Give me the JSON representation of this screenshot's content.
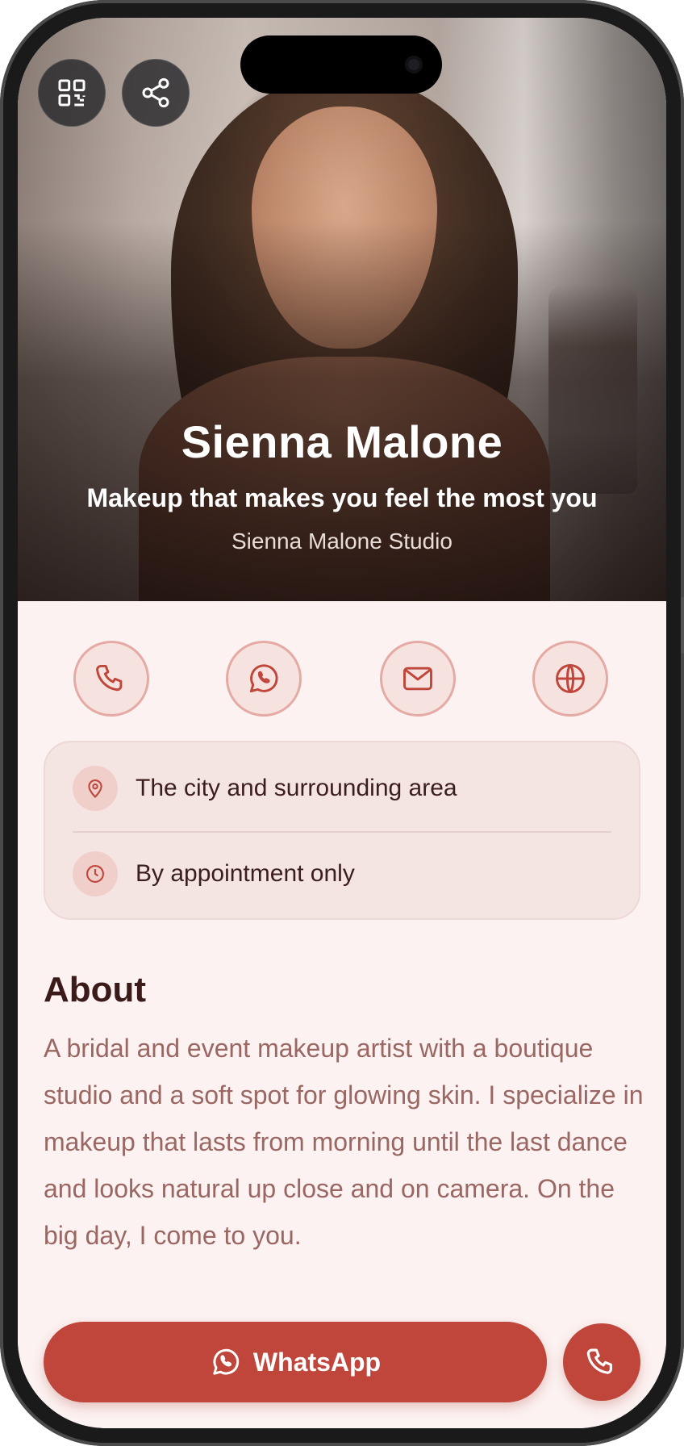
{
  "hero": {
    "name": "Sienna Malone",
    "tagline": "Makeup that makes you feel the most you",
    "studio": "Sienna Malone Studio",
    "buttons": {
      "qr_icon": "qr-code-icon",
      "share_icon": "share-icon"
    }
  },
  "actions": [
    {
      "id": "phone",
      "icon": "phone-icon"
    },
    {
      "id": "whatsapp",
      "icon": "whatsapp-icon"
    },
    {
      "id": "email",
      "icon": "mail-icon"
    },
    {
      "id": "website",
      "icon": "globe-icon"
    }
  ],
  "info": {
    "location": "The city and surrounding area",
    "hours": "By appointment only"
  },
  "about": {
    "title": "About",
    "body": "A bridal and event makeup artist with a boutique studio and a soft spot for glowing skin. I specialize in makeup that lasts from morning until the last dance and looks natural up close and on camera. On the big day, I come to you."
  },
  "bottom_bar": {
    "whatsapp_label": "WhatsApp",
    "call_icon": "phone-icon"
  },
  "colors": {
    "accent": "#c0463b",
    "accent_soft": "#e5aaa3",
    "background": "#fcf2f1",
    "heading": "#3b1b1a",
    "body_text": "#9a6763"
  }
}
